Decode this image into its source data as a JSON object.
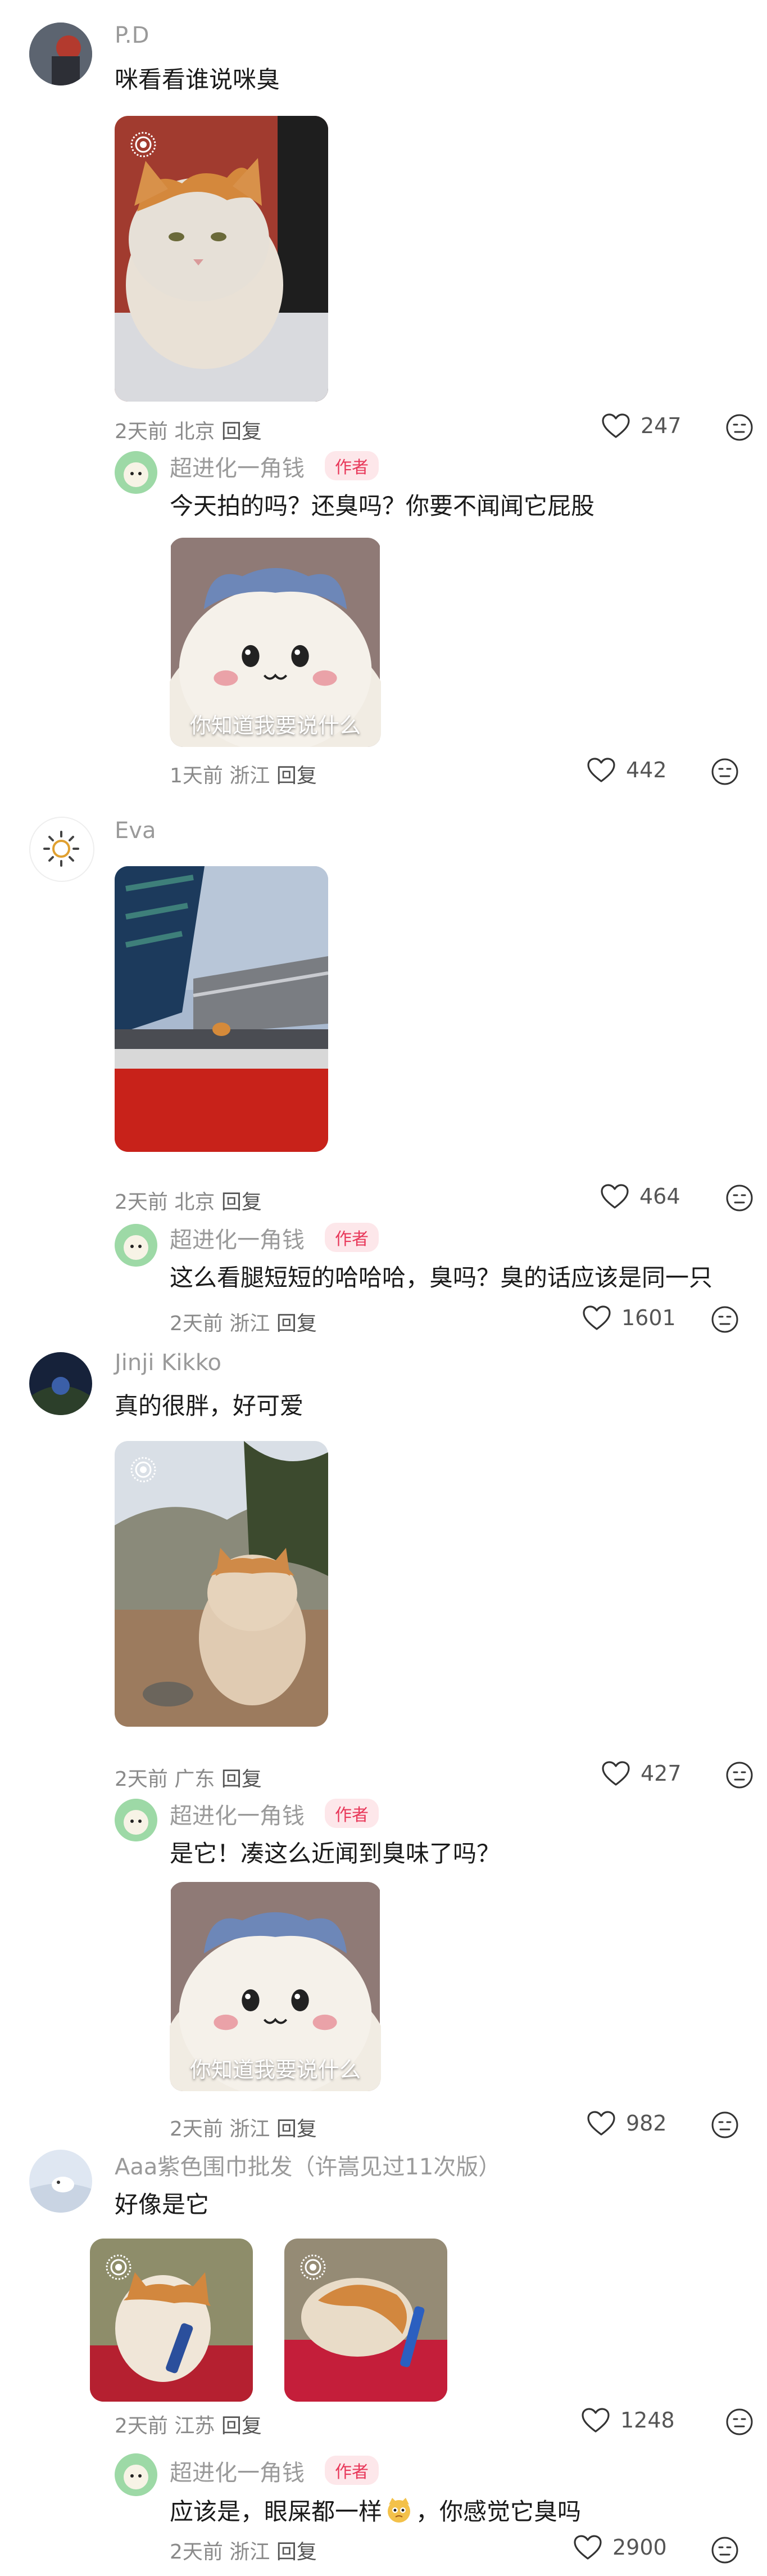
{
  "comments": [
    {
      "user": "P.D",
      "text": "咪看看谁说咪臭",
      "meta_time": "2天前",
      "meta_loc": "北京",
      "reply": "回复",
      "likes": "247",
      "reply_item": {
        "user": "超进化一角钱",
        "tag": "作者",
        "text": "今天拍的吗？还臭吗？你要不闻闻它屁股",
        "sticker_caption": "你知道我要说什么",
        "meta_time": "1天前",
        "meta_loc": "浙江",
        "reply": "回复",
        "likes": "442"
      }
    },
    {
      "user": "Eva",
      "meta_time": "2天前",
      "meta_loc": "北京",
      "reply": "回复",
      "likes": "464",
      "reply_item": {
        "user": "超进化一角钱",
        "tag": "作者",
        "text": "这么看腿短短的哈哈哈，臭吗？臭的话应该是同一只",
        "meta_time": "2天前",
        "meta_loc": "浙江",
        "reply": "回复",
        "likes": "1601"
      }
    },
    {
      "user": "Jinji Kikko",
      "text": "真的很胖，好可爱",
      "meta_time": "2天前",
      "meta_loc": "广东",
      "reply": "回复",
      "likes": "427",
      "reply_item": {
        "user": "超进化一角钱",
        "tag": "作者",
        "text": "是它！凑这么近闻到臭味了吗？",
        "sticker_caption": "你知道我要说什么",
        "meta_time": "2天前",
        "meta_loc": "浙江",
        "reply": "回复",
        "likes": "982"
      }
    },
    {
      "user": "Aaa紫色围巾批发（许嵩见过11次版）",
      "text": "好像是它",
      "meta_time": "2天前",
      "meta_loc": "江苏",
      "reply": "回复",
      "likes": "1248",
      "reply_item": {
        "user": "超进化一角钱",
        "tag": "作者",
        "text_a": "应该是，眼屎都一样",
        "text_b": "，你感觉它臭吗",
        "meta_time": "2天前",
        "meta_loc": "浙江",
        "reply": "回复",
        "likes": "2900"
      }
    }
  ],
  "icons": {
    "like": "heart-outline-icon",
    "dislike": "sad-face-icon",
    "live_photo": "live-photo-icon",
    "emoji": "cat-emoji-icon"
  },
  "colors": {
    "author_tag_bg": "#fde7ea",
    "author_tag_text": "#e8385a",
    "username": "#9a9a9a",
    "meta": "#8a8a8a"
  }
}
